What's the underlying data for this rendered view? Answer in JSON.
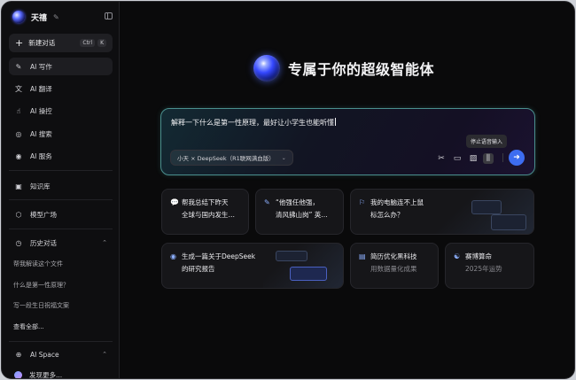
{
  "sidebar": {
    "brand_name": "天禧",
    "new_chat": {
      "label": "新建对话",
      "shortcut_ctrl": "Ctrl",
      "shortcut_key": "K"
    },
    "nav": [
      {
        "label": "AI 写作",
        "icon": "pen-icon"
      },
      {
        "label": "AI 翻译",
        "icon": "translate-icon"
      },
      {
        "label": "AI 操控",
        "icon": "control-icon"
      },
      {
        "label": "AI 搜索",
        "icon": "search-icon"
      },
      {
        "label": "AI 服务",
        "icon": "service-icon"
      }
    ],
    "knowledge": "知识库",
    "models": "模型广场",
    "history": {
      "title": "历史对话",
      "items": [
        "帮我解读这个文件",
        "什么是第一性原理？",
        "写一段生日祝福文案"
      ],
      "see_all": "查看全部..."
    },
    "space": {
      "title": "AI Space",
      "discover": "发现更多..."
    }
  },
  "main": {
    "hero_title": "专属于你的超级智能体",
    "composer": {
      "text": "解释一下什么是第一性原理，最好让小学生也能听懂",
      "model": "小天 × DeepSeek（R1联网满血版）",
      "tooltip": "停止语音输入"
    },
    "cards": [
      {
        "icon": "chat-icon",
        "line1": "帮我总结下昨天",
        "line2": "全球与国内发生…"
      },
      {
        "icon": "quote-icon",
        "line1": "“他强任他强，",
        "line2": "清风拂山岗” 英…"
      },
      {
        "icon": "help-icon",
        "line1": "我的电脑连不上鼠",
        "line2": "标怎么办？"
      },
      {
        "icon": "doc-icon",
        "line1": "生成一篇关于DeepSeek",
        "line2": "的研究报告"
      },
      {
        "icon": "resume-icon",
        "line1": "简历优化黑科技",
        "line2": "用数据量化成果"
      },
      {
        "icon": "fortune-icon",
        "line1": "赛博算命",
        "line2": "2025年运势"
      }
    ]
  }
}
